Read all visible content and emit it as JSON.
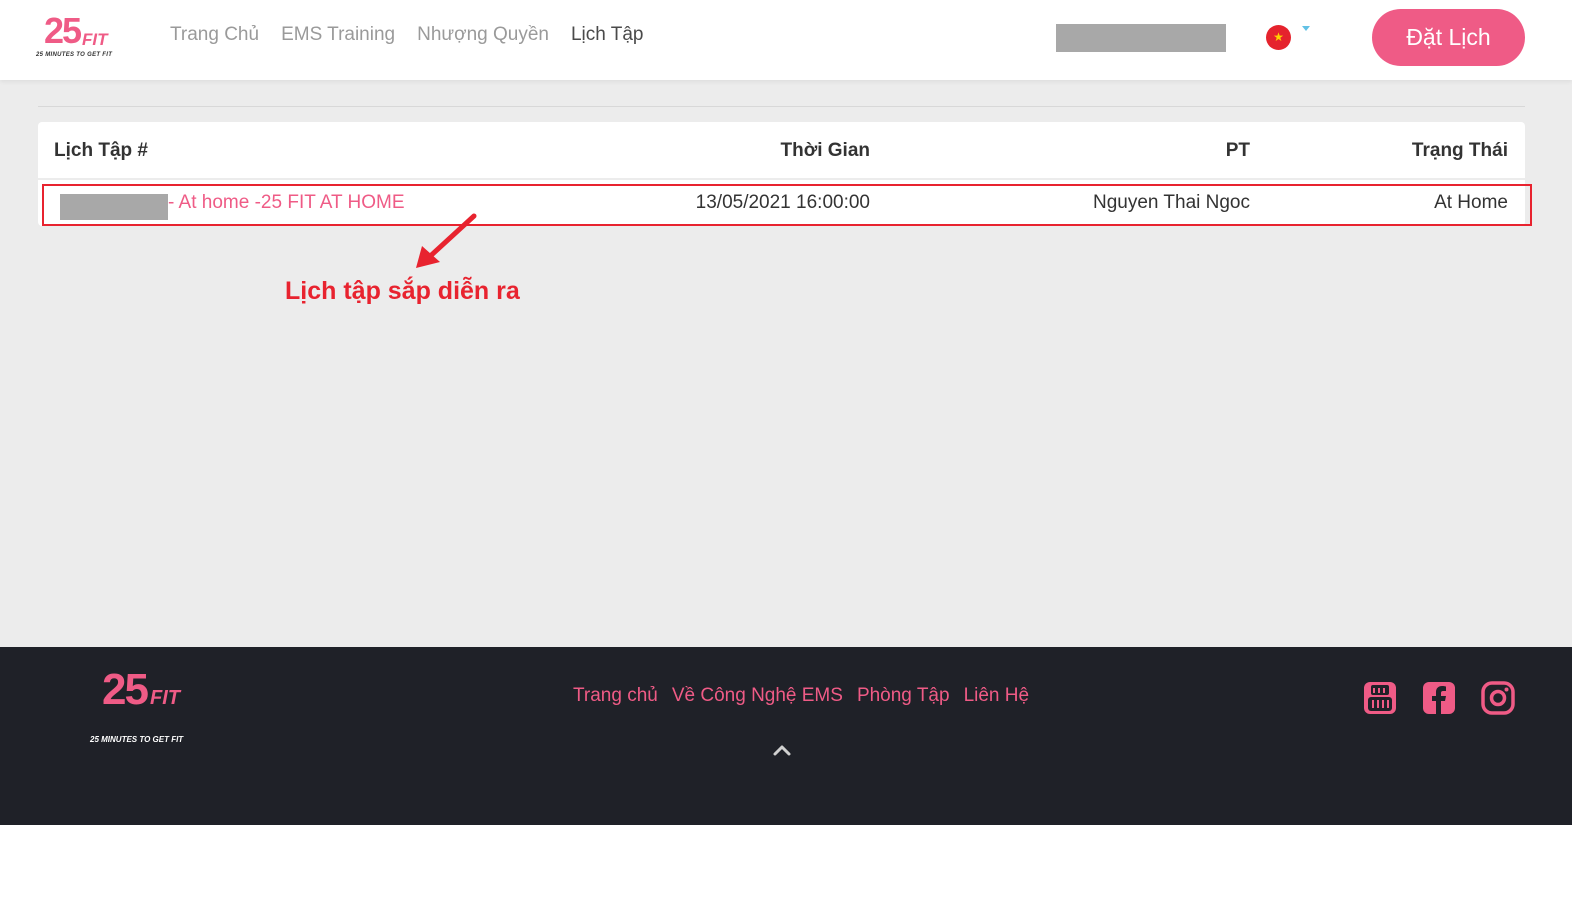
{
  "header": {
    "logo": {
      "number": "25",
      "word": "FIT",
      "tagline": "25 MINUTES TO GET FIT"
    },
    "nav": [
      {
        "label": "Trang Chủ",
        "active": false
      },
      {
        "label": "EMS Training",
        "active": false
      },
      {
        "label": "Nhượng Quyền",
        "active": false
      },
      {
        "label": "Lịch Tập",
        "active": true
      }
    ],
    "flag_icon": "vietnam-flag-icon",
    "flag_star": "★",
    "book_button": "Đặt Lịch"
  },
  "table": {
    "columns": [
      "Lịch Tập #",
      "Thời Gian",
      "PT",
      "Trạng Thái"
    ],
    "rows": [
      {
        "title": "- At home -25 FIT AT HOME",
        "time": "13/05/2021 16:00:00",
        "pt": "Nguyen Thai Ngoc",
        "status": "At Home"
      }
    ]
  },
  "annotation": {
    "text": "Lịch tập sắp diễn ra"
  },
  "footer": {
    "logo": {
      "number": "25",
      "word": "FIT",
      "tagline": "25 MINUTES TO GET FIT"
    },
    "links": [
      "Trang chủ",
      "Về Công Nghệ EMS",
      "Phòng Tập",
      "Liên Hệ"
    ],
    "social_icons": [
      "youtube-icon",
      "facebook-icon",
      "instagram-icon"
    ]
  },
  "colors": {
    "brand": "#ef5b86",
    "annotation": "#e8232f",
    "footer_bg": "#1f2128",
    "page_bg": "#ececec"
  }
}
